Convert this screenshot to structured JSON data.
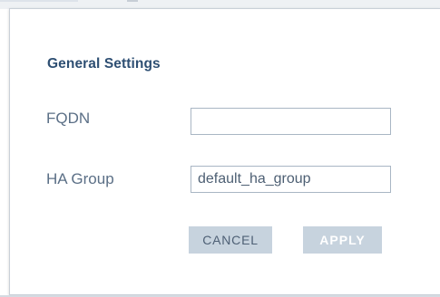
{
  "dialog": {
    "title": "General Settings",
    "fields": [
      {
        "label": "FQDN",
        "value": ""
      },
      {
        "label": "HA Group",
        "value": "default_ha_group"
      }
    ],
    "buttons": {
      "cancel_label": "CANCEL",
      "apply_label": "APPLY"
    }
  },
  "colors": {
    "title": "#2e4f73",
    "label": "#5b6f86",
    "input_border": "#a9b6c4",
    "button_bg": "#c7d3de",
    "cancel_text": "#4e6075",
    "apply_text": "#ffffff"
  }
}
